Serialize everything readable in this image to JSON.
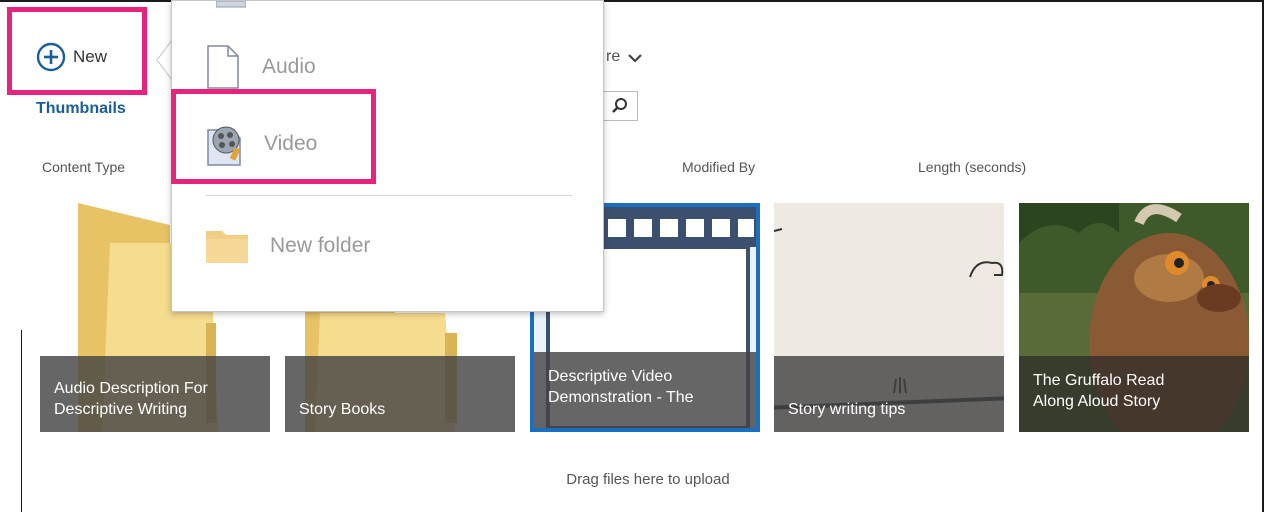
{
  "toolbar": {
    "new_label": "New",
    "more_fragment": "re"
  },
  "view": {
    "current": "Thumbnails"
  },
  "columns": [
    "Content Type",
    "Modified By",
    "Length (seconds)"
  ],
  "tiles": [
    {
      "line1": "Audio Description For",
      "line2": "Descriptive Writing",
      "kind": "folder"
    },
    {
      "line1": "Story Books",
      "line2": "",
      "kind": "folder"
    },
    {
      "line1": "Descriptive Video",
      "line2": "Demonstration - The",
      "kind": "video"
    },
    {
      "line1": "Story writing tips",
      "line2": "",
      "kind": "video"
    },
    {
      "line1": "The Gruffalo Read",
      "line2": "Along Aloud Story",
      "kind": "video"
    }
  ],
  "new_menu": {
    "items": [
      {
        "label": "Audio",
        "icon": "audio-file-icon"
      },
      {
        "label": "Video",
        "icon": "video-file-icon"
      },
      {
        "label": "New folder",
        "icon": "folder-icon"
      }
    ]
  },
  "drop_zone": {
    "text": "Drag files here to upload"
  },
  "colors": {
    "highlight": "#e8237e",
    "accent": "#1a5d9b",
    "selected_border": "#1b6fc1",
    "folder": "#f3d27a"
  }
}
